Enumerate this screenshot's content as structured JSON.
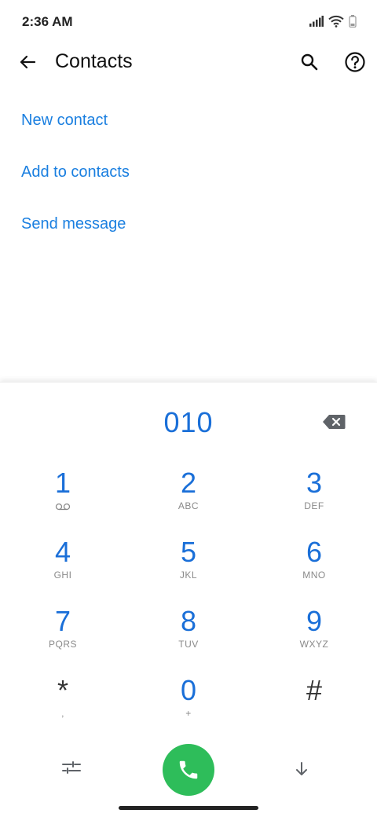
{
  "status_bar": {
    "time": "2:36 AM",
    "icons": [
      "signal-icon",
      "wifi-icon",
      "battery-icon"
    ]
  },
  "app_bar": {
    "title": "Contacts",
    "icons": [
      "back-arrow-icon",
      "search-icon",
      "help-icon"
    ]
  },
  "actions": [
    {
      "label": "New contact"
    },
    {
      "label": "Add to contacts"
    },
    {
      "label": "Send message"
    }
  ],
  "dialer": {
    "number": "010",
    "keys": [
      {
        "digit": "1",
        "letters": ""
      },
      {
        "digit": "2",
        "letters": "ABC"
      },
      {
        "digit": "3",
        "letters": "DEF"
      },
      {
        "digit": "4",
        "letters": "GHI"
      },
      {
        "digit": "5",
        "letters": "JKL"
      },
      {
        "digit": "6",
        "letters": "MNO"
      },
      {
        "digit": "7",
        "letters": "PQRS"
      },
      {
        "digit": "8",
        "letters": "TUV"
      },
      {
        "digit": "9",
        "letters": "WXYZ"
      },
      {
        "digit": "*",
        "letters": ","
      },
      {
        "digit": "0",
        "letters": "+"
      },
      {
        "digit": "#",
        "letters": ""
      }
    ]
  },
  "colors": {
    "accent": "#1a7fe0",
    "digit": "#1a6fd8",
    "call": "#2ebd5a"
  }
}
